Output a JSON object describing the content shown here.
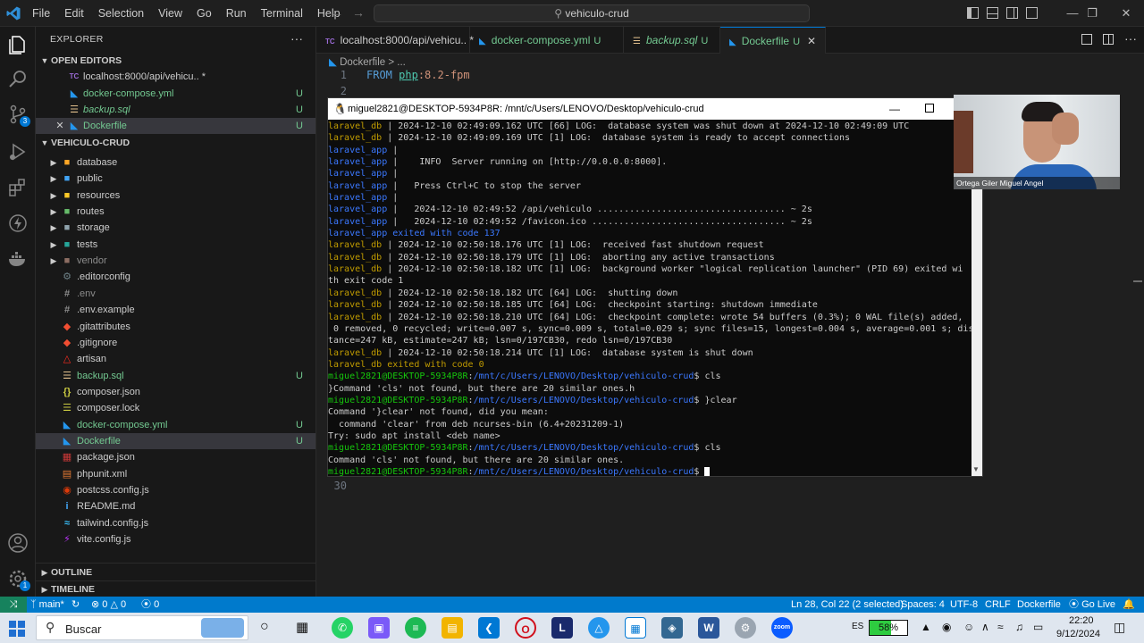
{
  "titlebar": {
    "menu": [
      "File",
      "Edit",
      "Selection",
      "View",
      "Go",
      "Run",
      "Terminal",
      "Help"
    ],
    "search_text": "vehiculo-crud"
  },
  "explorer": {
    "title": "EXPLORER",
    "open_editors_label": "OPEN EDITORS",
    "open_editors": [
      {
        "icon": "TC",
        "name": "localhost:8000/api/vehicu.. *",
        "badge": "",
        "italic": false
      },
      {
        "icon": "docker",
        "name": "docker-compose.yml",
        "badge": "U",
        "italic": false
      },
      {
        "icon": "db",
        "name": "backup.sql",
        "badge": "U",
        "italic": true
      },
      {
        "icon": "docker",
        "name": "Dockerfile",
        "badge": "U",
        "italic": false
      }
    ],
    "project_label": "VEHICULO-CRUD",
    "tree": [
      {
        "type": "folder",
        "name": "database",
        "badge": ""
      },
      {
        "type": "folder",
        "name": "public",
        "badge": ""
      },
      {
        "type": "folder",
        "name": "resources",
        "badge": ""
      },
      {
        "type": "folder",
        "name": "routes",
        "badge": ""
      },
      {
        "type": "folder",
        "name": "storage",
        "badge": ""
      },
      {
        "type": "folder",
        "name": "tests",
        "badge": ""
      },
      {
        "type": "folder",
        "name": "vendor",
        "badge": ""
      },
      {
        "type": "file",
        "icon": "gear",
        "name": ".editorconfig",
        "badge": ""
      },
      {
        "type": "file",
        "icon": "env",
        "name": ".env",
        "badge": ""
      },
      {
        "type": "file",
        "icon": "env",
        "name": ".env.example",
        "badge": ""
      },
      {
        "type": "file",
        "icon": "git",
        "name": ".gitattributes",
        "badge": ""
      },
      {
        "type": "file",
        "icon": "git",
        "name": ".gitignore",
        "badge": ""
      },
      {
        "type": "file",
        "icon": "laravel",
        "name": "artisan",
        "badge": ""
      },
      {
        "type": "file",
        "icon": "db",
        "name": "backup.sql",
        "badge": "U"
      },
      {
        "type": "file",
        "icon": "json",
        "name": "composer.json",
        "badge": ""
      },
      {
        "type": "file",
        "icon": "lock",
        "name": "composer.lock",
        "badge": ""
      },
      {
        "type": "file",
        "icon": "docker",
        "name": "docker-compose.yml",
        "badge": "U"
      },
      {
        "type": "file",
        "icon": "docker",
        "name": "Dockerfile",
        "badge": "U"
      },
      {
        "type": "file",
        "icon": "npm",
        "name": "package.json",
        "badge": ""
      },
      {
        "type": "file",
        "icon": "xml",
        "name": "phpunit.xml",
        "badge": ""
      },
      {
        "type": "file",
        "icon": "postcss",
        "name": "postcss.config.js",
        "badge": ""
      },
      {
        "type": "file",
        "icon": "info",
        "name": "README.md",
        "badge": ""
      },
      {
        "type": "file",
        "icon": "tailwind",
        "name": "tailwind.config.js",
        "badge": ""
      },
      {
        "type": "file",
        "icon": "vite",
        "name": "vite.config.js",
        "badge": ""
      }
    ],
    "outline_label": "OUTLINE",
    "timeline_label": "TIMELINE"
  },
  "tabs": [
    {
      "icon": "TC",
      "label": "localhost:8000/api/vehicu.. *",
      "badge": ""
    },
    {
      "icon": "docker",
      "label": "docker-compose.yml",
      "badge": "U"
    },
    {
      "icon": "db",
      "label": "backup.sql",
      "badge": "U"
    },
    {
      "icon": "docker",
      "label": "Dockerfile",
      "badge": "U"
    }
  ],
  "editor": {
    "breadcrumb": "Dockerfile > ...",
    "line1_num": "1",
    "line1_kw": "FROM",
    "line1_img": "php",
    "line1_tag": ":8.2-fpm",
    "line2_num": "2",
    "line30_num": "30"
  },
  "terminal": {
    "title": "miguel2821@DESKTOP-5934P8R: /mnt/c/Users/LENOVO/Desktop/vehiculo-crud",
    "lines": [
      {
        "p": "laravel_db ",
        "pc": "db",
        "t": "| 2024-12-10 02:49:09.162 UTC [66] LOG:  database system was shut down at 2024-12-10 02:49:09 UTC"
      },
      {
        "p": "laravel_db ",
        "pc": "db",
        "t": "| 2024-12-10 02:49:09.169 UTC [1] LOG:  database system is ready to accept connections"
      },
      {
        "p": "laravel_app ",
        "pc": "app",
        "t": "|"
      },
      {
        "p": "laravel_app ",
        "pc": "app",
        "t": "|    INFO  Server running on [http://0.0.0.0:8000]."
      },
      {
        "p": "laravel_app ",
        "pc": "app",
        "t": "|"
      },
      {
        "p": "laravel_app ",
        "pc": "app",
        "t": "|   Press Ctrl+C to stop the server"
      },
      {
        "p": "laravel_app ",
        "pc": "app",
        "t": "|"
      },
      {
        "p": "laravel_app ",
        "pc": "app",
        "t": "|   2024-12-10 02:49:52 /api/vehiculo ................................... ~ 2s"
      },
      {
        "p": "laravel_app ",
        "pc": "app",
        "t": "|   2024-12-10 02:49:52 /favicon.ico .................................... ~ 2s"
      },
      {
        "p": "laravel_app exited with code 137",
        "pc": "app",
        "t": ""
      },
      {
        "p": "laravel_db ",
        "pc": "db",
        "t": "| 2024-12-10 02:50:18.176 UTC [1] LOG:  received fast shutdown request"
      },
      {
        "p": "laravel_db ",
        "pc": "db",
        "t": "| 2024-12-10 02:50:18.179 UTC [1] LOG:  aborting any active transactions"
      },
      {
        "p": "laravel_db ",
        "pc": "db",
        "t": "| 2024-12-10 02:50:18.182 UTC [1] LOG:  background worker \"logical replication launcher\" (PID 69) exited wi"
      },
      {
        "p": "",
        "pc": "",
        "t": "th exit code 1"
      },
      {
        "p": "laravel_db ",
        "pc": "db",
        "t": "| 2024-12-10 02:50:18.182 UTC [64] LOG:  shutting down"
      },
      {
        "p": "laravel_db ",
        "pc": "db",
        "t": "| 2024-12-10 02:50:18.185 UTC [64] LOG:  checkpoint starting: shutdown immediate"
      },
      {
        "p": "laravel_db ",
        "pc": "db",
        "t": "| 2024-12-10 02:50:18.210 UTC [64] LOG:  checkpoint complete: wrote 54 buffers (0.3%); 0 WAL file(s) added,"
      },
      {
        "p": "",
        "pc": "",
        "t": " 0 removed, 0 recycled; write=0.007 s, sync=0.009 s, total=0.029 s; sync files=15, longest=0.004 s, average=0.001 s; dis"
      },
      {
        "p": "",
        "pc": "",
        "t": "tance=247 kB, estimate=247 kB; lsn=0/197CB30, redo lsn=0/197CB30"
      },
      {
        "p": "laravel_db ",
        "pc": "db",
        "t": "| 2024-12-10 02:50:18.214 UTC [1] LOG:  database system is shut down"
      },
      {
        "p": "laravel_db exited with code 0",
        "pc": "db",
        "t": ""
      },
      {
        "prompt": "miguel2821@DESKTOP-5934P8R",
        "path": "/mnt/c/Users/LENOVO/Desktop/vehiculo-crud",
        "cmd": "$ cls"
      },
      {
        "p": "",
        "pc": "",
        "t": "}Command 'cls' not found, but there are 20 similar ones.h"
      },
      {
        "prompt": "miguel2821@DESKTOP-5934P8R",
        "path": "/mnt/c/Users/LENOVO/Desktop/vehiculo-crud",
        "cmd": "$ }clear"
      },
      {
        "p": "",
        "pc": "",
        "t": "Command '}clear' not found, did you mean:"
      },
      {
        "p": "",
        "pc": "",
        "t": "  command 'clear' from deb ncurses-bin (6.4+20231209-1)"
      },
      {
        "p": "",
        "pc": "",
        "t": "Try: sudo apt install <deb name>"
      },
      {
        "prompt": "miguel2821@DESKTOP-5934P8R",
        "path": "/mnt/c/Users/LENOVO/Desktop/vehiculo-crud",
        "cmd": "$ cls"
      },
      {
        "p": "",
        "pc": "",
        "t": "Command 'cls' not found, but there are 20 similar ones."
      },
      {
        "prompt": "miguel2821@DESKTOP-5934P8R",
        "path": "/mnt/c/Users/LENOVO/Desktop/vehiculo-crud",
        "cmd": "$ "
      }
    ]
  },
  "webcam": {
    "name": "Ortega Giler Miguel Angel"
  },
  "statusbar": {
    "branch": "main*",
    "errors": "0",
    "warnings": "0",
    "ports": "0",
    "cursor": "Ln 28, Col 22 (2 selected)",
    "spaces": "Spaces: 4",
    "encoding": "UTF-8",
    "eol": "CRLF",
    "language": "Dockerfile",
    "golive": "Go Live"
  },
  "taskbar": {
    "search_placeholder": "Buscar",
    "lang": "ES",
    "battery": "58%",
    "time": "22:20",
    "date": "9/12/2024"
  },
  "colors": {
    "accent": "#0078d4",
    "statusbar": "#007acc",
    "untracked": "#73c991"
  }
}
